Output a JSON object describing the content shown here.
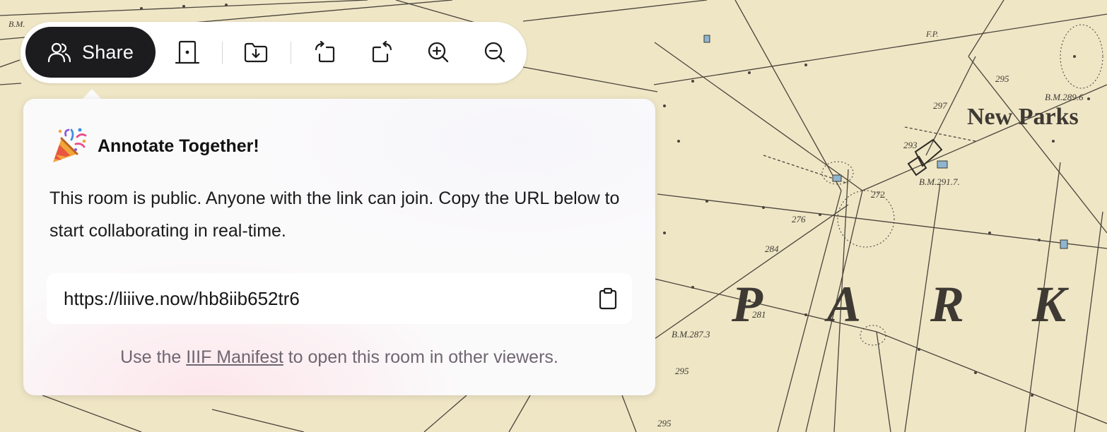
{
  "toolbar": {
    "share_label": "Share",
    "tools": [
      {
        "name": "door-icon"
      },
      {
        "name": "download-folder-icon"
      },
      {
        "name": "rotate-left-icon"
      },
      {
        "name": "rotate-right-icon"
      },
      {
        "name": "zoom-in-icon"
      },
      {
        "name": "zoom-out-icon"
      }
    ]
  },
  "popover": {
    "title": "Annotate Together!",
    "body": "This room is public. Anyone with the link can join. Copy the URL below to start collaborating in real-time.",
    "url": "https://liiive.now/hb8iib652tr6",
    "footer_before": "Use the ",
    "footer_link": "IIIF Manifest",
    "footer_after": " to open this room in other viewers."
  },
  "map": {
    "labels": {
      "new_parks": "New Parks",
      "park_p": "P",
      "park_a": "A",
      "park_r": "R",
      "park_k": "K",
      "bm_top": "B.M.",
      "bm_2896": "B.M.289.6",
      "bm_2917": "B.M.291.7.",
      "bm_2873": "B.M.287.3",
      "fp": "F.P.",
      "n295a": "295",
      "n297": "297",
      "n293": "293",
      "n272": "272",
      "n276": "276",
      "n284": "284",
      "n281": "281",
      "n295b": "295",
      "n295c": "295"
    }
  },
  "colors": {
    "map_paper": "#efe6c6",
    "share_bg": "#1c1c1e",
    "water": "#8fb5cf"
  }
}
